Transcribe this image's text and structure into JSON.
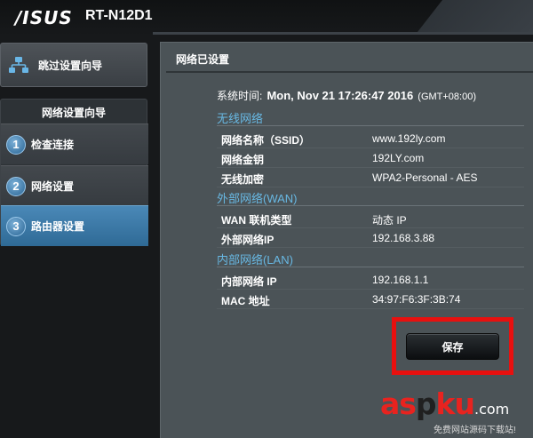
{
  "header": {
    "brand_logo": "/ISUS",
    "model": "RT-N12D1"
  },
  "sidebar": {
    "skip_wizard_label": "跳过设置向导",
    "wizard_title": "网络设置向导",
    "steps": [
      {
        "number": "1",
        "label": "检查连接"
      },
      {
        "number": "2",
        "label": "网络设置"
      },
      {
        "number": "3",
        "label": "路由器设置"
      }
    ]
  },
  "main": {
    "title": "网络已设置",
    "system_time": {
      "label": "系统时间:",
      "value": "Mon, Nov 21 17:26:47 2016",
      "timezone": "(GMT+08:00)"
    },
    "sections": [
      {
        "title": "无线网络",
        "rows": [
          {
            "label": "网络名称（SSID）",
            "value": "www.192ly.com"
          },
          {
            "label": "网络金钥",
            "value": "192LY.com"
          },
          {
            "label": "无线加密",
            "value": "WPA2-Personal - AES"
          }
        ]
      },
      {
        "title": "外部网络(WAN)",
        "rows": [
          {
            "label": "WAN 联机类型",
            "value": "动态 IP"
          },
          {
            "label": "外部网络IP",
            "value": "192.168.3.88"
          }
        ]
      },
      {
        "title": "内部网络(LAN)",
        "rows": [
          {
            "label": "内部网络 IP",
            "value": "192.168.1.1"
          },
          {
            "label": "MAC 地址",
            "value": "34:97:F6:3F:3B:74"
          }
        ]
      }
    ],
    "save_label": "保存"
  },
  "watermark": {
    "red_a": "as",
    "dark_p": "p",
    "red_ku": "ku",
    "dotcom": ".com",
    "subtitle": "免费网站源码下载站!"
  },
  "colors": {
    "accent_blue": "#68b8e3",
    "highlight_red": "#e8100f",
    "active_step": "#3a7aa8"
  }
}
